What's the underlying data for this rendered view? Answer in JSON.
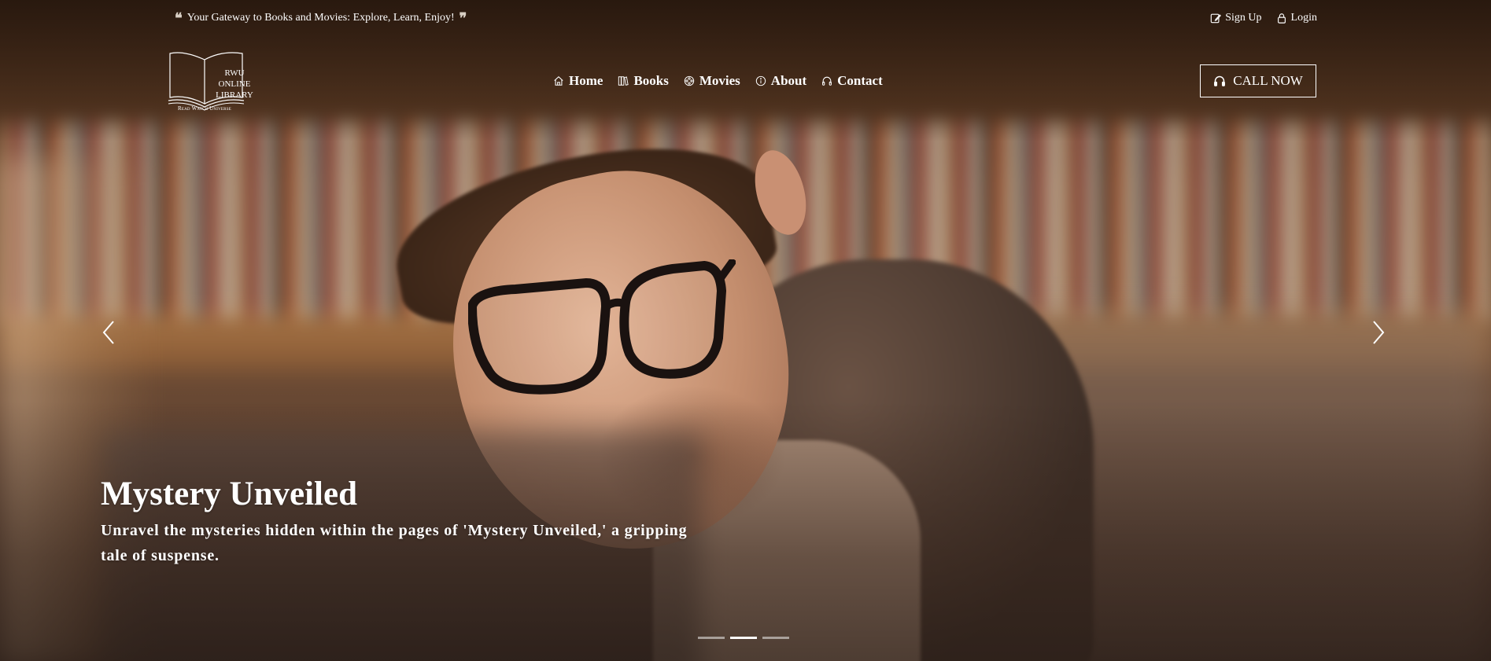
{
  "topbar": {
    "tagline": "Your Gateway to Books and Movies: Explore, Learn, Enjoy!",
    "open_quote": "❝",
    "close_quote": "❞",
    "signup_label": "Sign Up",
    "login_label": "Login"
  },
  "brand": {
    "line1": "RWU",
    "line2": "ONLINE",
    "line3": "LIBRARY",
    "tagline": "Read Watch Universe"
  },
  "nav": {
    "items": [
      {
        "label": "Home",
        "icon": "home-icon"
      },
      {
        "label": "Books",
        "icon": "books-icon"
      },
      {
        "label": "Movies",
        "icon": "film-reel-icon"
      },
      {
        "label": "About",
        "icon": "info-icon"
      },
      {
        "label": "Contact",
        "icon": "headphones-icon"
      }
    ]
  },
  "cta": {
    "call_label": "CALL NOW",
    "icon": "headphones-icon"
  },
  "carousel": {
    "title": "Mystery Unveiled",
    "description": "Unravel the mysteries hidden within the pages of 'Mystery Unveiled,' a gripping tale of suspense.",
    "slide_count": 3,
    "active_slide": 2
  },
  "colors": {
    "text": "#ffffff",
    "background_dark": "#3a2618",
    "indicator_inactive": "rgba(255,255,255,0.5)"
  }
}
